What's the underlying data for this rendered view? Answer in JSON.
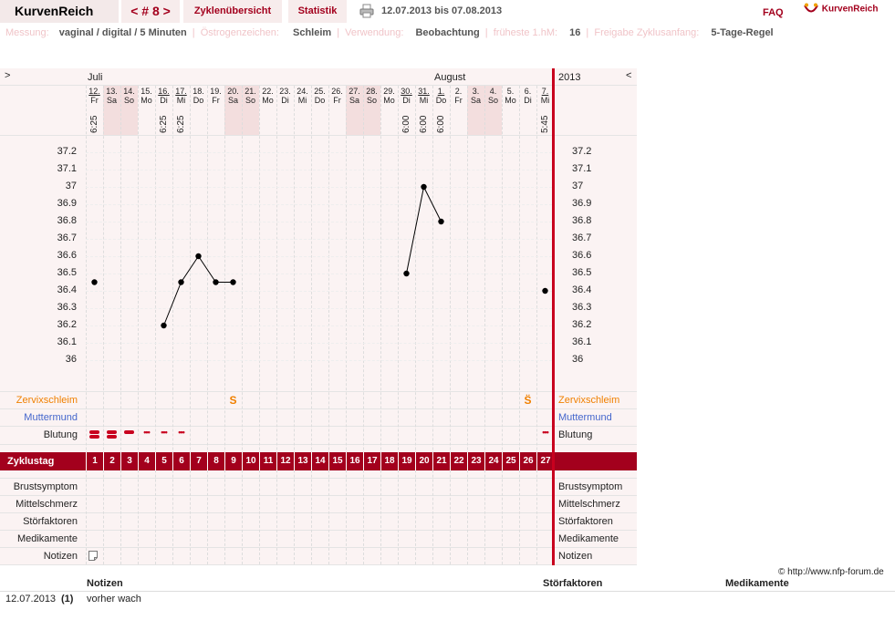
{
  "header": {
    "app_name": "KurvenReich",
    "cycle_label": "< # 8 >",
    "tab_overview": "Zyklenübersicht",
    "tab_statistics": "Statistik",
    "date_range": "12.07.2013 bis 07.08.2013",
    "faq": "FAQ",
    "logo_text": "KurvenReich"
  },
  "info": {
    "measurement_label": "Messung:",
    "measurement_value": "vaginal / digital / 5 Minuten",
    "estrogen_label": "Östrogenzeichen:",
    "estrogen_value": "Schleim",
    "usage_label": "Verwendung:",
    "usage_value": "Beobachtung",
    "earliest_label": "früheste 1.hM:",
    "earliest_value": "16",
    "release_label": "Freigabe Zyklusanfang:",
    "release_value": "5-Tage-Regel"
  },
  "chart_header": {
    "nav_left": ">",
    "nav_right": "<",
    "month1": "Juli",
    "month2": "August",
    "year": "2013"
  },
  "days": [
    {
      "d": "12.",
      "w": "Fr",
      "t": "6:25",
      "we": false
    },
    {
      "d": "13.",
      "w": "Sa",
      "t": "",
      "we": true
    },
    {
      "d": "14.",
      "w": "So",
      "t": "",
      "we": true
    },
    {
      "d": "15.",
      "w": "Mo",
      "t": "",
      "we": false
    },
    {
      "d": "16.",
      "w": "Di",
      "t": "6:25",
      "we": false
    },
    {
      "d": "17.",
      "w": "Mi",
      "t": "6:25",
      "we": false
    },
    {
      "d": "18.",
      "w": "Do",
      "t": "",
      "we": false
    },
    {
      "d": "19.",
      "w": "Fr",
      "t": "",
      "we": false
    },
    {
      "d": "20.",
      "w": "Sa",
      "t": "",
      "we": true
    },
    {
      "d": "21.",
      "w": "So",
      "t": "",
      "we": true
    },
    {
      "d": "22.",
      "w": "Mo",
      "t": "",
      "we": false
    },
    {
      "d": "23.",
      "w": "Di",
      "t": "",
      "we": false
    },
    {
      "d": "24.",
      "w": "Mi",
      "t": "",
      "we": false
    },
    {
      "d": "25.",
      "w": "Do",
      "t": "",
      "we": false
    },
    {
      "d": "26.",
      "w": "Fr",
      "t": "",
      "we": false
    },
    {
      "d": "27.",
      "w": "Sa",
      "t": "",
      "we": true
    },
    {
      "d": "28.",
      "w": "So",
      "t": "",
      "we": true
    },
    {
      "d": "29.",
      "w": "Mo",
      "t": "",
      "we": false
    },
    {
      "d": "30.",
      "w": "Di",
      "t": "6:00",
      "we": false
    },
    {
      "d": "31.",
      "w": "Mi",
      "t": "6:00",
      "we": false
    },
    {
      "d": "1.",
      "w": "Do",
      "t": "6:00",
      "we": false
    },
    {
      "d": "2.",
      "w": "Fr",
      "t": "",
      "we": false
    },
    {
      "d": "3.",
      "w": "Sa",
      "t": "",
      "we": true
    },
    {
      "d": "4.",
      "w": "So",
      "t": "",
      "we": true
    },
    {
      "d": "5.",
      "w": "Mo",
      "t": "",
      "we": false
    },
    {
      "d": "6.",
      "w": "Di",
      "t": "",
      "we": false
    },
    {
      "d": "7.",
      "w": "Mi",
      "t": "5:45",
      "we": false
    }
  ],
  "chart_data": {
    "type": "line",
    "y_ticks": [
      "37.2",
      "37.1",
      "37",
      "36.9",
      "36.8",
      "36.7",
      "36.6",
      "36.5",
      "36.4",
      "36.3",
      "36.2",
      "36.1",
      "36"
    ],
    "ylim": [
      36.0,
      37.2
    ],
    "x": [
      1,
      2,
      3,
      4,
      5,
      6,
      7,
      8,
      9,
      10,
      11,
      12,
      13,
      14,
      15,
      16,
      17,
      18,
      19,
      20,
      21,
      22,
      23,
      24,
      25,
      26,
      27
    ],
    "values": [
      36.45,
      null,
      null,
      null,
      36.2,
      36.45,
      36.6,
      36.45,
      36.45,
      null,
      null,
      null,
      null,
      null,
      null,
      null,
      null,
      null,
      36.5,
      37.0,
      36.8,
      null,
      null,
      null,
      null,
      null,
      36.4
    ],
    "line_segments": [
      [
        5,
        9
      ],
      [
        19,
        21
      ]
    ]
  },
  "rows": {
    "cervix_label": "Zervixschleim",
    "cervix_marks": [
      {
        "day": 9,
        "sym": "S"
      },
      {
        "day": 26,
        "sym": "S̈"
      }
    ],
    "mouth_label": "Muttermund",
    "bleeding_label": "Blutung",
    "bleeding": [
      {
        "day": 1,
        "sym": "heavy"
      },
      {
        "day": 2,
        "sym": "heavy"
      },
      {
        "day": 3,
        "sym": "medium"
      },
      {
        "day": 4,
        "sym": "light"
      },
      {
        "day": 5,
        "sym": "light"
      },
      {
        "day": 6,
        "sym": "light"
      },
      {
        "day": 27,
        "sym": "light"
      }
    ],
    "cycle_day_label": "Zyklustag",
    "cycle_days": [
      "1",
      "2",
      "3",
      "4",
      "5",
      "6",
      "7",
      "8",
      "9",
      "10",
      "11",
      "12",
      "13",
      "14",
      "15",
      "16",
      "17",
      "18",
      "19",
      "20",
      "21",
      "22",
      "23",
      "24",
      "25",
      "26",
      "27"
    ],
    "breast_label": "Brustsymptom",
    "midpain_label": "Mittelschmerz",
    "disturb_label": "Störfaktoren",
    "meds_label": "Medikamente",
    "notes_label": "Notizen"
  },
  "footer": {
    "credit": "© http://www.nfp-forum.de",
    "col_notes": "Notizen",
    "col_disturb": "Störfaktoren",
    "col_meds": "Medikamente",
    "note_date": "12.07.2013",
    "note_day": "(1)",
    "note_text": "vorher wach"
  }
}
